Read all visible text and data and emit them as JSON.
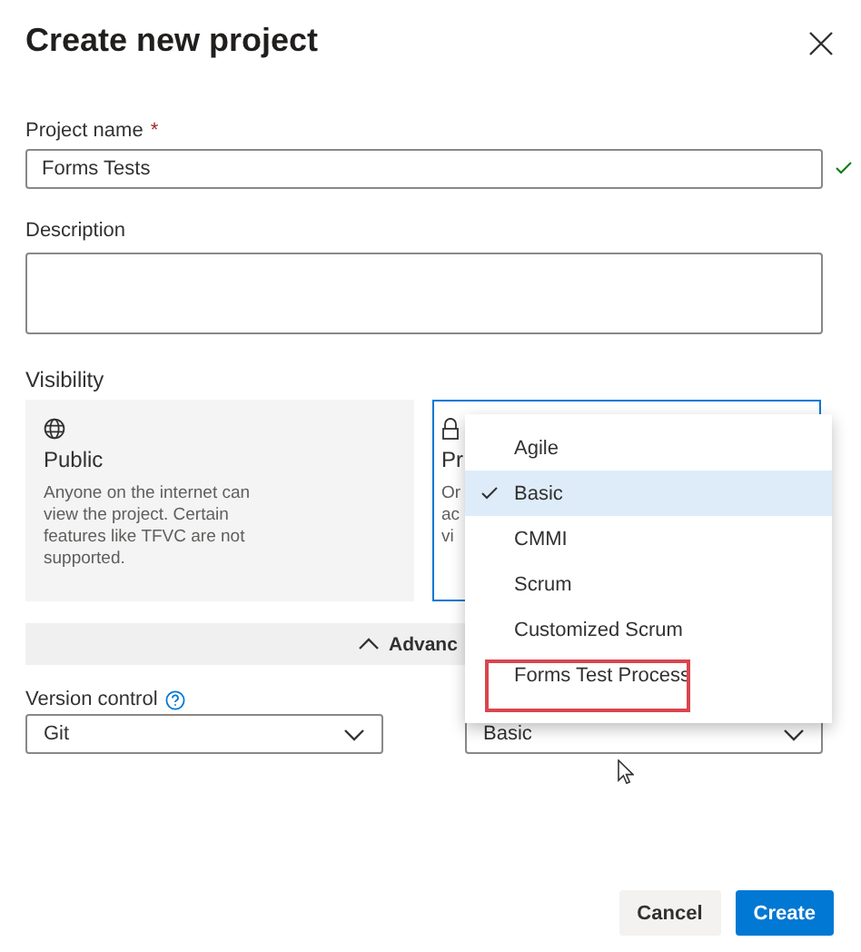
{
  "dialog": {
    "title": "Create new project"
  },
  "project_name": {
    "label": "Project name",
    "required_mark": "*",
    "value": "Forms Tests",
    "valid": true
  },
  "description": {
    "label": "Description"
  },
  "visibility": {
    "label": "Visibility",
    "options": [
      {
        "kind": "public",
        "title": "Public",
        "description": "Anyone on the internet can view the project. Certain features like TFVC are not supported.",
        "selected": false
      },
      {
        "kind": "private",
        "title": "Pr",
        "description_lines": [
          "Or",
          "ac",
          "vi"
        ],
        "selected": true
      }
    ]
  },
  "advanced": {
    "label": "Advanc",
    "expanded": true
  },
  "version_control": {
    "label": "Version control",
    "value": "Git"
  },
  "process": {
    "value": "Basic",
    "menu": [
      {
        "label": "Agile",
        "selected": false,
        "annotated": false
      },
      {
        "label": "Basic",
        "selected": true,
        "annotated": false
      },
      {
        "label": "CMMI",
        "selected": false,
        "annotated": false
      },
      {
        "label": "Scrum",
        "selected": false,
        "annotated": false
      },
      {
        "label": "Customized Scrum",
        "selected": false,
        "annotated": false
      },
      {
        "label": "Forms Test Process",
        "selected": false,
        "annotated": true
      }
    ]
  },
  "buttons": [
    {
      "label": "Cancel",
      "kind": "secondary"
    },
    {
      "label": "Create",
      "kind": "primary"
    }
  ]
}
